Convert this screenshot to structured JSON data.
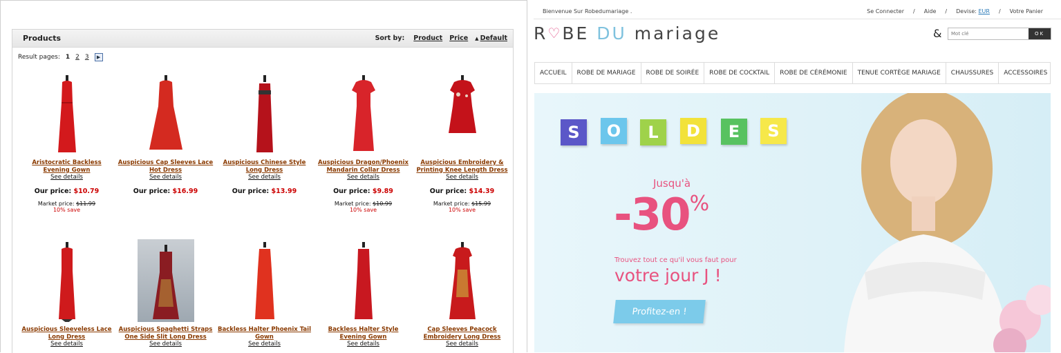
{
  "store": {
    "panel_title": "Products",
    "sort_label": "Sort by:",
    "sort_options": [
      "Product",
      "Price",
      "Default"
    ],
    "pages_label": "Result pages:",
    "pages": [
      "1",
      "2",
      "3"
    ],
    "products": [
      {
        "name": "Aristocratic Backless Evening Gown",
        "details": "See details",
        "our_label": "Our price:",
        "our_price": "$10.79",
        "market_label": "Market price:",
        "market_price": "$11.99",
        "save": "10% save"
      },
      {
        "name": "Auspicious Cap Sleeves Lace Hot Dress",
        "details": "See details",
        "our_label": "Our price:",
        "our_price": "$16.99",
        "market_label": "",
        "market_price": "",
        "save": ""
      },
      {
        "name": "Auspicious Chinese Style Long Dress",
        "details": "See details",
        "our_label": "Our price:",
        "our_price": "$13.99",
        "market_label": "",
        "market_price": "",
        "save": ""
      },
      {
        "name": "Auspicious Dragon/Phoenix Mandarin Collar Dress",
        "details": "See details",
        "our_label": "Our price:",
        "our_price": "$9.89",
        "market_label": "Market price:",
        "market_price": "$10.99",
        "save": "10% save"
      },
      {
        "name": "Auspicious Embroidery & Printing Knee Length Dress",
        "details": "See details",
        "our_label": "Our price:",
        "our_price": "$14.39",
        "market_label": "Market price:",
        "market_price": "$15.99",
        "save": "10% save"
      },
      {
        "name": "Auspicious Sleeveless Lace Long Dress",
        "details": "See details"
      },
      {
        "name": "Auspicious Spaghetti Straps One Side Slit Long Dress",
        "details": "See details"
      },
      {
        "name": "Backless Halter Phoenix Tail Gown",
        "details": "See details"
      },
      {
        "name": "Backless Halter Style Evening Gown",
        "details": "See details"
      },
      {
        "name": "Cap Sleeves Peacock Embroidery Long Dress",
        "details": "See details"
      }
    ]
  },
  "site": {
    "welcome": "Bienvenue Sur Robedumariage .",
    "top_links": [
      "Se Connecter",
      "/",
      "Aide",
      "/",
      "Devise:",
      "EUR",
      "/",
      "Votre Panier"
    ],
    "logo_r": "R",
    "logo_be": "BE",
    "logo_du": "DU",
    "logo_mariage": "mariage",
    "amp": "&",
    "search_placeholder": "Mot clé",
    "search_button": "OK",
    "nav": [
      "ACCUEIL",
      "ROBE DE MARIAGE",
      "ROBE DE SOIRÉE",
      "ROBE DE COCKTAIL",
      "ROBE DE CÉRÉMONIE",
      "TENUE CORTÈGE MARIAGE",
      "CHAUSSURES",
      "ACCESSOIRES"
    ],
    "soldes_letters": [
      "S",
      "O",
      "L",
      "D",
      "E",
      "S"
    ],
    "soldes_colors": [
      "#5b57c8",
      "#6cc6ec",
      "#9fd24a",
      "#f2e23a",
      "#58c260",
      "#f6e84a"
    ],
    "jusqu": "Jusqu'à",
    "discount": "-30",
    "percent": "%",
    "trouvez": "Trouvez tout ce qu'il vous faut pour",
    "jour": "votre jour J !",
    "cta": "Profitez-en !"
  }
}
